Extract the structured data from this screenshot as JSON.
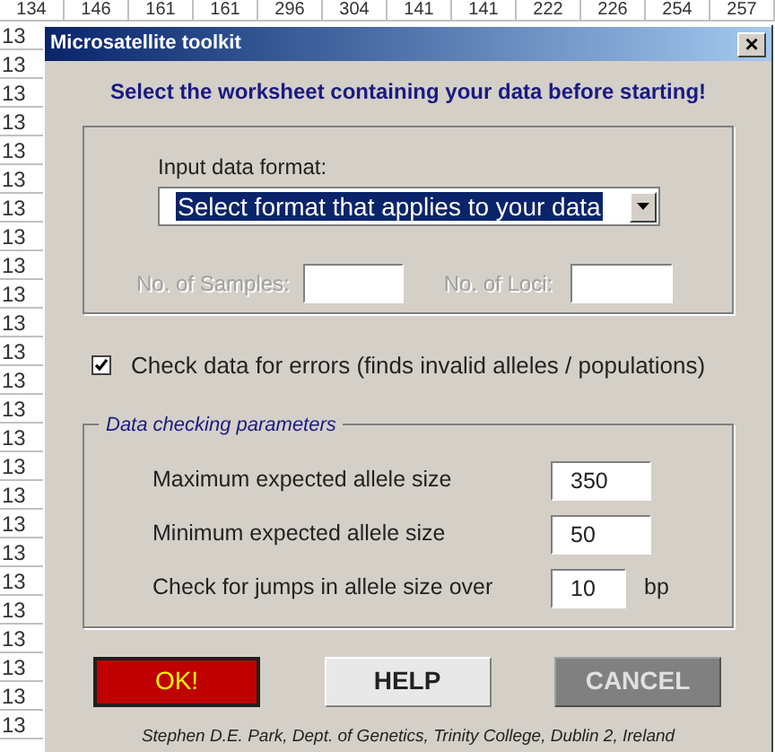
{
  "sheet": {
    "header": [
      "134",
      "146",
      "161",
      "161",
      "296",
      "304",
      "141",
      "141",
      "222",
      "226",
      "254",
      "257"
    ],
    "row_labels": [
      "13",
      "13",
      "13",
      "13",
      "13",
      "13",
      "13",
      "13",
      "13",
      "13",
      "13",
      "13",
      "13",
      "13",
      "13",
      "13",
      "13",
      "13",
      "13",
      "13",
      "13",
      "13",
      "13",
      "13",
      "13"
    ]
  },
  "window": {
    "title": "Microsatellite toolkit",
    "close": "×"
  },
  "heading": "Select the worksheet containing your data before starting!",
  "format": {
    "label": "Input data format:",
    "value": "Select format that applies to your data",
    "samples_label": "No. of Samples:",
    "loci_label": "No. of Loci:",
    "disabled": true
  },
  "check_errors": {
    "label": "Check data for errors (finds invalid alleles / populations)",
    "checked": true
  },
  "parameters": {
    "title": "Data checking parameters",
    "rows": [
      {
        "label": "Maximum expected allele size",
        "value": "350"
      },
      {
        "label": "Minimum expected allele size",
        "value": "50"
      },
      {
        "label": "Check for jumps in allele size over",
        "value": "10",
        "unit": "bp"
      }
    ]
  },
  "buttons": [
    {
      "label": "OK!",
      "kind": "primary"
    },
    {
      "label": "HELP",
      "kind": "normal"
    },
    {
      "label": "CANCEL",
      "kind": "dim"
    }
  ],
  "footer": "Stephen D.E. Park, Dept. of Genetics, Trinity College, Dublin 2, Ireland"
}
